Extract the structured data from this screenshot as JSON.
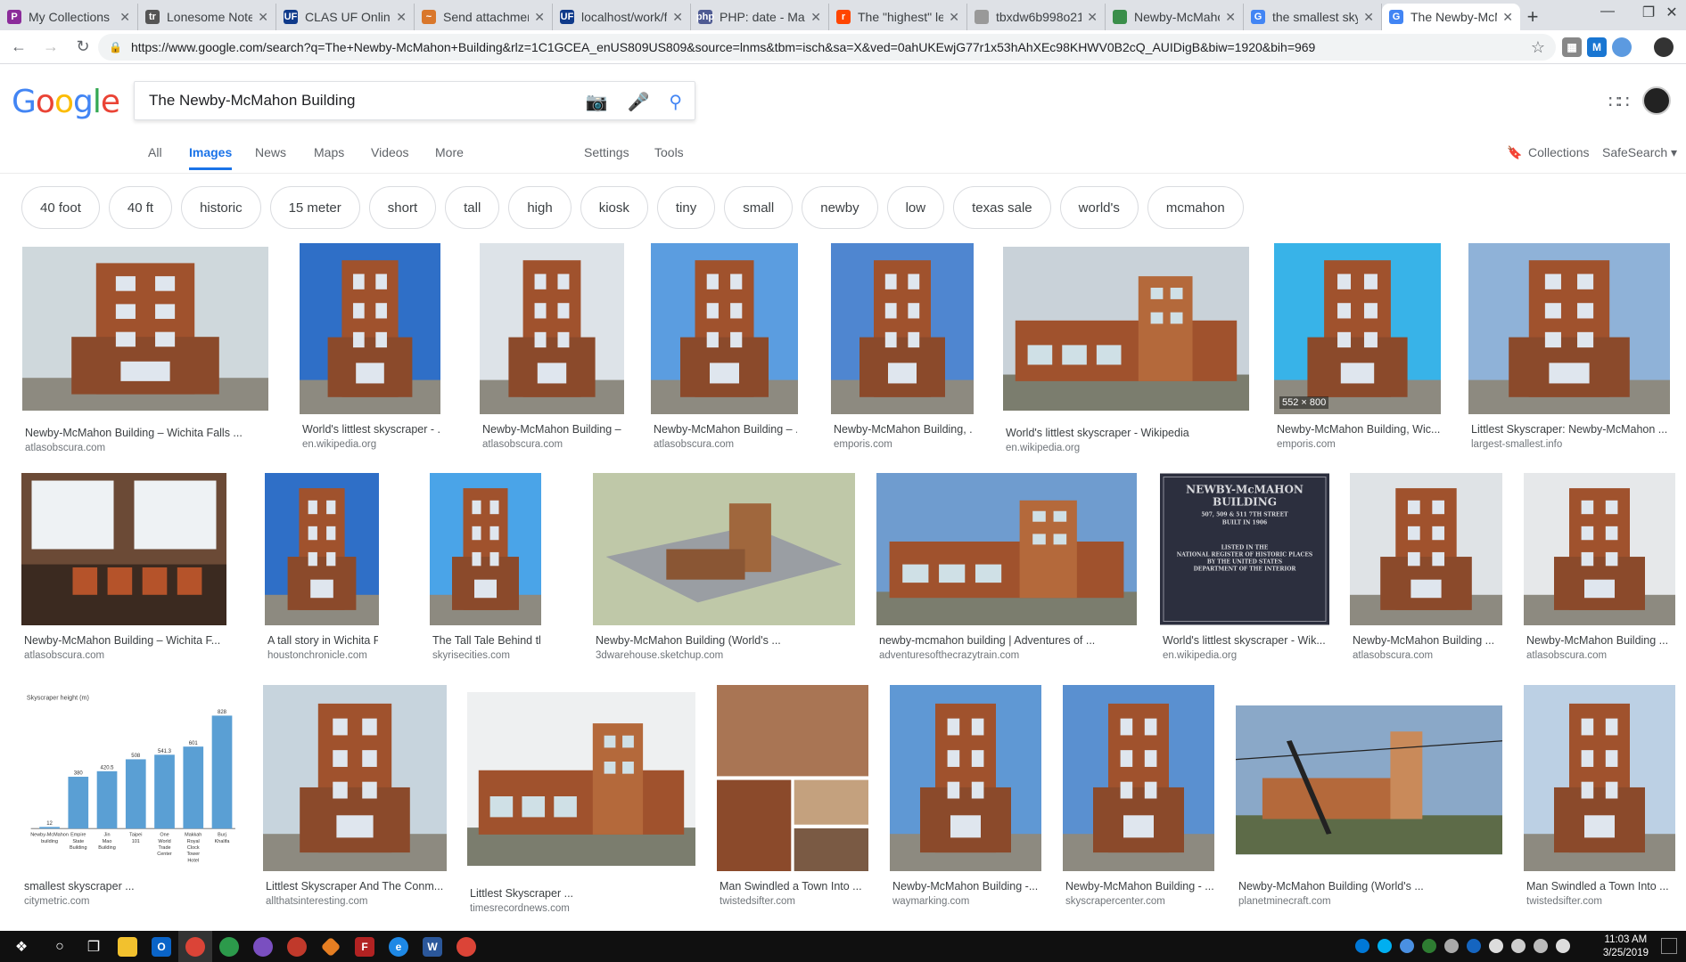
{
  "browser": {
    "tabs": [
      {
        "title": "My Collections",
        "fav": "P",
        "color": "#8b2b9a"
      },
      {
        "title": "Lonesome Notes",
        "fav": "tr",
        "color": "#555"
      },
      {
        "title": "CLAS UF Online",
        "fav": "UF",
        "color": "#0f3a8a"
      },
      {
        "title": "Send attachment",
        "fav": "~",
        "color": "#d9772b"
      },
      {
        "title": "localhost/work/f",
        "fav": "UF",
        "color": "#0f3a8a"
      },
      {
        "title": "PHP: date - Man",
        "fav": "php",
        "color": "#4f5b93"
      },
      {
        "title": "The \"highest\" lev",
        "fav": "r",
        "color": "#ff4500"
      },
      {
        "title": "tbxdw6b998o21",
        "fav": "",
        "color": "#999"
      },
      {
        "title": "Newby-McMahon",
        "fav": "",
        "color": "#3a8e4a"
      },
      {
        "title": "the smallest sky",
        "fav": "G",
        "color": "#4285f4"
      },
      {
        "title": "The Newby-McM",
        "fav": "G",
        "color": "#4285f4"
      }
    ],
    "new_tab": "+",
    "url": "https://www.google.com/search?q=The+Newby-McMahon+Building&rlz=1C1GCEA_enUS809US809&source=lnms&tbm=isch&sa=X&ved=0ahUKEwjG77r1x53hAhXEc98KHWV0B2cQ_AUIDigB&biw=1920&bih=969"
  },
  "google": {
    "logo": "Google",
    "query": "The Newby-McMahon Building",
    "nav": {
      "all": "All",
      "images": "Images",
      "news": "News",
      "maps": "Maps",
      "videos": "Videos",
      "more": "More",
      "settings": "Settings",
      "tools": "Tools",
      "collections": "Collections",
      "safesearch": "SafeSearch"
    },
    "chips": [
      "40 foot",
      "40 ft",
      "historic",
      "15 meter",
      "short",
      "tall",
      "high",
      "kiosk",
      "tiny",
      "small",
      "newby",
      "low",
      "texas sale",
      "world's",
      "mcmahon"
    ]
  },
  "results": [
    {
      "title": "Newby-McMahon Building – Wichita Falls ...",
      "source": "atlasobscura.com"
    },
    {
      "title": "World's littlest skyscraper - ...",
      "source": "en.wikipedia.org"
    },
    {
      "title": "Newby-McMahon Building – ...",
      "source": "atlasobscura.com"
    },
    {
      "title": "Newby-McMahon Building – ...",
      "source": "atlasobscura.com"
    },
    {
      "title": "Newby-McMahon Building, ...",
      "source": "emporis.com"
    },
    {
      "title": "World's littlest skyscraper - Wikipedia",
      "source": "en.wikipedia.org"
    },
    {
      "title": "Newby-McMahon Building, Wic...",
      "source": "emporis.com",
      "dims": "552 × 800"
    },
    {
      "title": "Littlest Skyscraper: Newby-McMahon ...",
      "source": "largest-smallest.info"
    },
    {
      "title": "Newby-McMahon Building – Wichita F...",
      "source": "atlasobscura.com"
    },
    {
      "title": "A tall story in Wichita Falls ...",
      "source": "houstonchronicle.com"
    },
    {
      "title": "The Tall Tale Behind the Wo...",
      "source": "skyrisecities.com"
    },
    {
      "title": "Newby-McMahon Building (World's ...",
      "source": "3dwarehouse.sketchup.com"
    },
    {
      "title": "newby-mcmahon building | Adventures of ...",
      "source": "adventuresofthecrazytrain.com"
    },
    {
      "title": "World's littlest skyscraper - Wik...",
      "source": "en.wikipedia.org"
    },
    {
      "title": "Newby-McMahon Building ...",
      "source": "atlasobscura.com"
    },
    {
      "title": "Newby-McMahon Building ...",
      "source": "atlasobscura.com"
    },
    {
      "title": "smallest skyscraper ...",
      "source": "citymetric.com"
    },
    {
      "title": "Littlest Skyscraper And The Conm...",
      "source": "allthatsinteresting.com"
    },
    {
      "title": "Littlest Skyscraper ...",
      "source": "timesrecordnews.com"
    },
    {
      "title": "Man Swindled a Town Into ...",
      "source": "twistedsifter.com"
    },
    {
      "title": "Newby-McMahon Building -...",
      "source": "waymarking.com"
    },
    {
      "title": "Newby-McMahon Building - ...",
      "source": "skyscrapercenter.com"
    },
    {
      "title": "Newby-McMahon Building (World's ...",
      "source": "planetminecraft.com"
    },
    {
      "title": "Man Swindled a Town Into ...",
      "source": "twistedsifter.com"
    }
  ],
  "plaque": {
    "l1": "NEWBY-McMAHON",
    "l2": "BUILDING",
    "l3": "507, 509 & 511 7TH STREET",
    "l4": "BUILT IN 1906",
    "l5": "LISTED IN THE",
    "l6": "NATIONAL REGISTER OF HISTORIC PLACES",
    "l7": "BY THE UNITED STATES",
    "l8": "DEPARTMENT OF THE INTERIOR"
  },
  "mini_chart": {
    "title": "Skyscraper height (m)",
    "categories": [
      "Newby-McMahon building",
      "Empire State Building",
      "Jin Mao Building",
      "Taipei 101",
      "One World Trade Center",
      "Makkah Royal Clock Tower Hotel",
      "Burj Khalifa"
    ],
    "values": [
      12,
      380,
      420.5,
      508,
      541.3,
      601,
      828
    ]
  },
  "taskbar": {
    "time": "11:03 AM",
    "date": "3/25/2019"
  }
}
